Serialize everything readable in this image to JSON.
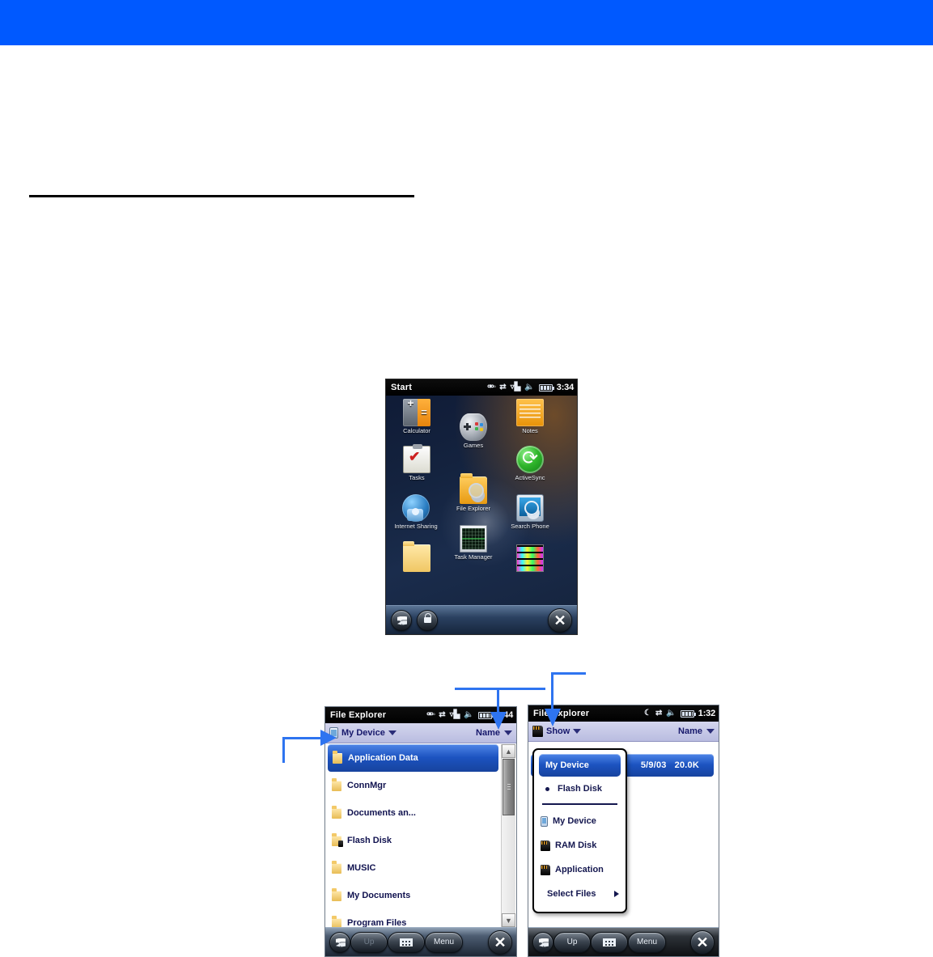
{
  "page": {
    "banner_color": "#0059FF",
    "rule_color": "#000000"
  },
  "start_screen": {
    "title": "Start",
    "clock": "3:34",
    "status_icons": [
      "headset-icon",
      "connectivity-arrows-icon",
      "signal-bars-icon",
      "speaker-icon",
      "battery-icon"
    ],
    "apps": [
      {
        "label": "Calculator",
        "icon": "calculator-icon"
      },
      {
        "label": "Notes",
        "icon": "notes-icon"
      },
      {
        "label": "Games",
        "icon": "gamepad-icon"
      },
      {
        "label": "Tasks",
        "icon": "tasks-clipboard-icon"
      },
      {
        "label": "ActiveSync",
        "icon": "activesync-icon"
      },
      {
        "label": "File Explorer",
        "icon": "file-explorer-icon"
      },
      {
        "label": "Internet Sharing",
        "icon": "internet-sharing-icon"
      },
      {
        "label": "Search Phone",
        "icon": "search-phone-icon"
      },
      {
        "label": "Task Manager",
        "icon": "task-manager-icon"
      },
      {
        "label": "",
        "icon": "folder-icon"
      },
      {
        "label": "",
        "icon": "pictures-icon"
      }
    ],
    "softkeys": {
      "start": "start-windows-icon",
      "lock": "lock-icon",
      "close": "close-x-icon"
    }
  },
  "file_explorer_left": {
    "title": "File Explorer",
    "clock": "3:44",
    "status_icons": [
      "headset-icon",
      "connectivity-arrows-icon",
      "signal-bars-icon",
      "speaker-icon",
      "battery-icon"
    ],
    "address": {
      "label": "My Device",
      "icon": "device-icon"
    },
    "sort": {
      "label": "Name"
    },
    "rows": [
      {
        "name": "Application Data",
        "icon": "folder-icon",
        "selected": true
      },
      {
        "name": "ConnMgr",
        "icon": "folder-icon",
        "selected": false
      },
      {
        "name": "Documents an...",
        "icon": "folder-icon",
        "selected": false
      },
      {
        "name": "Flash Disk",
        "icon": "folder-card-icon",
        "selected": false
      },
      {
        "name": "MUSIC",
        "icon": "folder-icon",
        "selected": false
      },
      {
        "name": "My Documents",
        "icon": "folder-icon",
        "selected": false
      },
      {
        "name": "Program Files",
        "icon": "folder-icon",
        "selected": false
      }
    ],
    "scrollbar": {
      "up": "▲",
      "down": "▼"
    },
    "softkeys": {
      "start": "start-windows-icon",
      "up": "Up",
      "keyboard": "keyboard-icon",
      "menu": "Menu",
      "close": "close-x-icon"
    }
  },
  "file_explorer_right": {
    "title": "File Explorer",
    "clock": "1:32",
    "status_icons": [
      "phone-tower-icon",
      "connectivity-arrows-icon",
      "speaker-icon",
      "battery-icon"
    ],
    "address": {
      "label": "Show",
      "icon": "storage-card-icon"
    },
    "sort": {
      "label": "Name"
    },
    "background_row": {
      "date": "5/9/03",
      "size": "20.0K"
    },
    "dropdown": {
      "items": [
        {
          "label": "My Device",
          "icon": null,
          "highlighted": true,
          "bulleted": false,
          "accel": "M"
        },
        {
          "label": "Flash Disk",
          "icon": null,
          "highlighted": false,
          "bulleted": true,
          "accel": "F"
        },
        {
          "separator_after": true
        },
        {
          "label": "My Device",
          "icon": "device-icon",
          "highlighted": false,
          "bulleted": false
        },
        {
          "label": "RAM Disk",
          "icon": "storage-card-icon",
          "highlighted": false,
          "bulleted": false
        },
        {
          "label": "Application",
          "icon": "storage-card-icon",
          "highlighted": false,
          "bulleted": false
        },
        {
          "label": "Select Files",
          "icon": null,
          "highlighted": false,
          "bulleted": false,
          "submenu": true,
          "accel": "S"
        }
      ]
    },
    "softkeys": {
      "start": "start-windows-icon",
      "up": "Up",
      "keyboard": "keyboard-icon",
      "menu": "Menu",
      "close": "close-x-icon"
    }
  },
  "callouts": [
    {
      "name": "callout-my-device",
      "direction": "right"
    },
    {
      "name": "callout-sort-name",
      "direction": "down"
    },
    {
      "name": "callout-show",
      "direction": "down"
    }
  ]
}
